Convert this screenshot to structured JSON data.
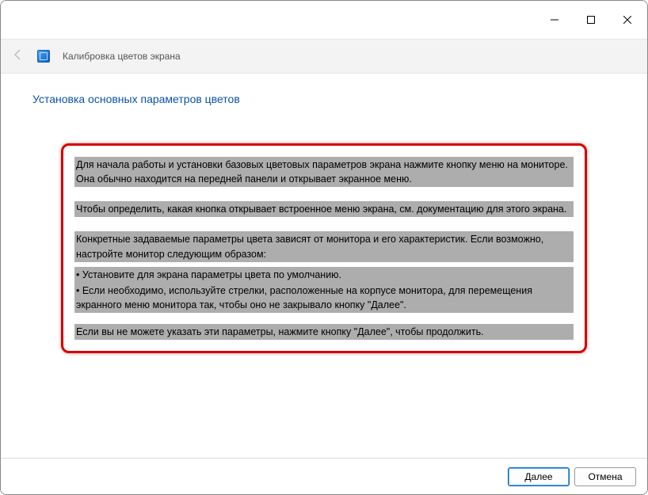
{
  "window": {
    "title": "Калибровка цветов экрана"
  },
  "page": {
    "heading": "Установка основных параметров цветов"
  },
  "body": {
    "p1": "Для начала работы и установки базовых цветовых параметров экрана нажмите кнопку меню на мониторе. Она обычно находится на передней панели и открывает экранное меню.",
    "p2": "Чтобы определить, какая кнопка открывает встроенное меню экрана, см. документацию для этого экрана.",
    "p3": "Конкретные задаваемые параметры цвета зависят от монитора и его характеристик. Если возможно, настройте монитор следующим образом:",
    "b1": "• Установите для экрана параметры цвета по умолчанию.",
    "b2": "• Если необходимо, используйте стрелки, расположенные на корпусе монитора, для перемещения экранного меню монитора так, чтобы оно не закрывало кнопку \"Далее\".",
    "p4": "Если вы не можете указать эти параметры, нажмите кнопку \"Далее\", чтобы продолжить."
  },
  "footer": {
    "next": "Далее",
    "cancel": "Отмена"
  }
}
